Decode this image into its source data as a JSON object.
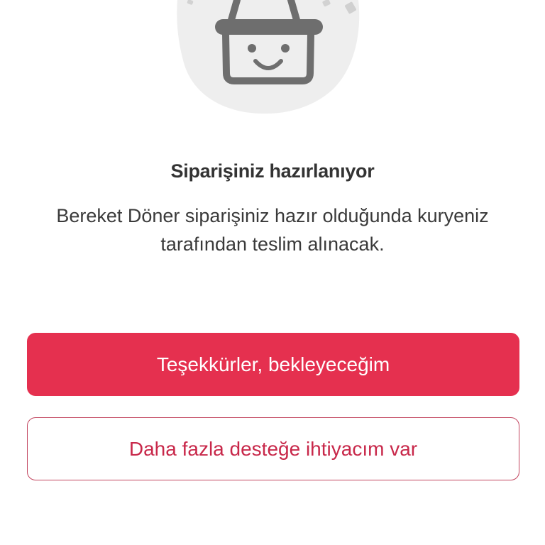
{
  "status": {
    "illustration_icon": "smiling-basket-icon",
    "title": "Siparişiniz hazırlanıyor",
    "message": "Bereket Döner siparişiniz hazır olduğunda kuryeniz tarafından teslim alınacak."
  },
  "actions": {
    "primary_label": "Teşekkürler, bekleyeceğim",
    "secondary_label": "Daha fazla desteğe ihtiyacım var"
  },
  "colors": {
    "accent": "#E5304F",
    "secondary_text": "#C8284A",
    "secondary_border": "#C2445E",
    "illustration_blob": "#EEEEEE",
    "illustration_stroke": "#6E6E6E"
  }
}
